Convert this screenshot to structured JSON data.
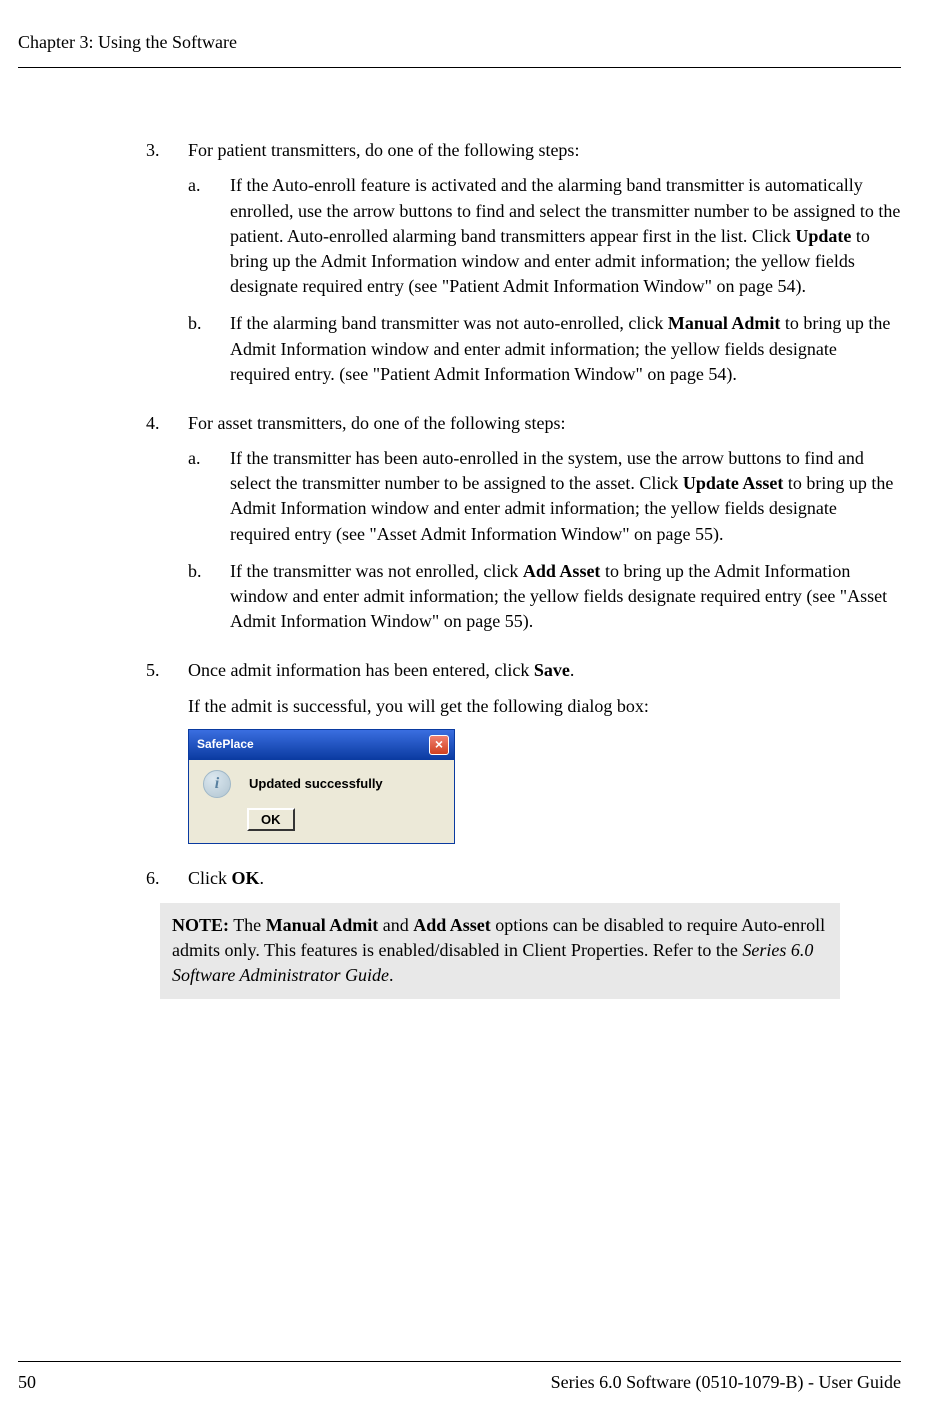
{
  "header": {
    "chapter_title": "Chapter 3: Using the Software"
  },
  "items": {
    "3": {
      "num": "3.",
      "intro": "For patient transmitters, do one of the following steps:",
      "a": {
        "letter": "a.",
        "p1": "If the Auto-enroll feature is activated and the alarming band transmitter is automatically enrolled, use the arrow buttons to find and select the transmitter number to be assigned to the patient. Auto-enrolled alarming band transmitters appear first in the list. Click ",
        "bold1": "Update",
        "p2": " to bring up the Admit Information window and enter admit information; the yellow fields designate required entry (see \"Patient Admit Information Window\" on page 54)."
      },
      "b": {
        "letter": "b.",
        "p1": "If the alarming band transmitter was not auto-enrolled, click ",
        "bold1": "Manual Admit",
        "p2": " to bring up the Admit Information window and enter admit information; the yellow fields designate required entry. (see \"Patient Admit Information Window\" on page 54)."
      }
    },
    "4": {
      "num": "4.",
      "intro": "For asset transmitters, do one of the following steps:",
      "a": {
        "letter": "a.",
        "p1": "If the transmitter has been auto-enrolled in the system, use the arrow buttons to find and select the transmitter number to be assigned to the asset. Click ",
        "bold1": "Update Asset",
        "p2": " to bring up the Admit Information window and enter admit information; the yellow fields designate required entry (see \"Asset Admit Information Window\" on page 55)."
      },
      "b": {
        "letter": "b.",
        "p1": "If the transmitter was not enrolled, click ",
        "bold1": "Add Asset",
        "p2": " to bring up the Admit Information window and enter admit information; the yellow fields designate required entry (see \"Asset Admit Information Window\" on page 55)."
      }
    },
    "5": {
      "num": "5.",
      "line1a": "Once admit information has been entered, click ",
      "bold1": "Save",
      "line1b": ".",
      "line2": "If the admit is successful, you will get the following dialog box:"
    },
    "6": {
      "num": "6.",
      "p1": "Click ",
      "bold1": "OK",
      "p2": "."
    }
  },
  "dialog": {
    "title": "SafePlace",
    "close_label": "×",
    "icon_glyph": "i",
    "message": "Updated successfully",
    "ok_label": "OK"
  },
  "note": {
    "label": "NOTE:",
    "p1": " The ",
    "bold1": "Manual Admit",
    "p2": " and ",
    "bold2": "Add Asset",
    "p3": " options can be disabled to require Auto-enroll admits only. This features is enabled/disabled in Client Properties. Refer to the ",
    "italic1": "Series 6.0 Software Administrator Guide",
    "p4": "."
  },
  "footer": {
    "page_num": "50",
    "doc_title": "Series 6.0 Software (0510-1079-B) - User Guide"
  }
}
